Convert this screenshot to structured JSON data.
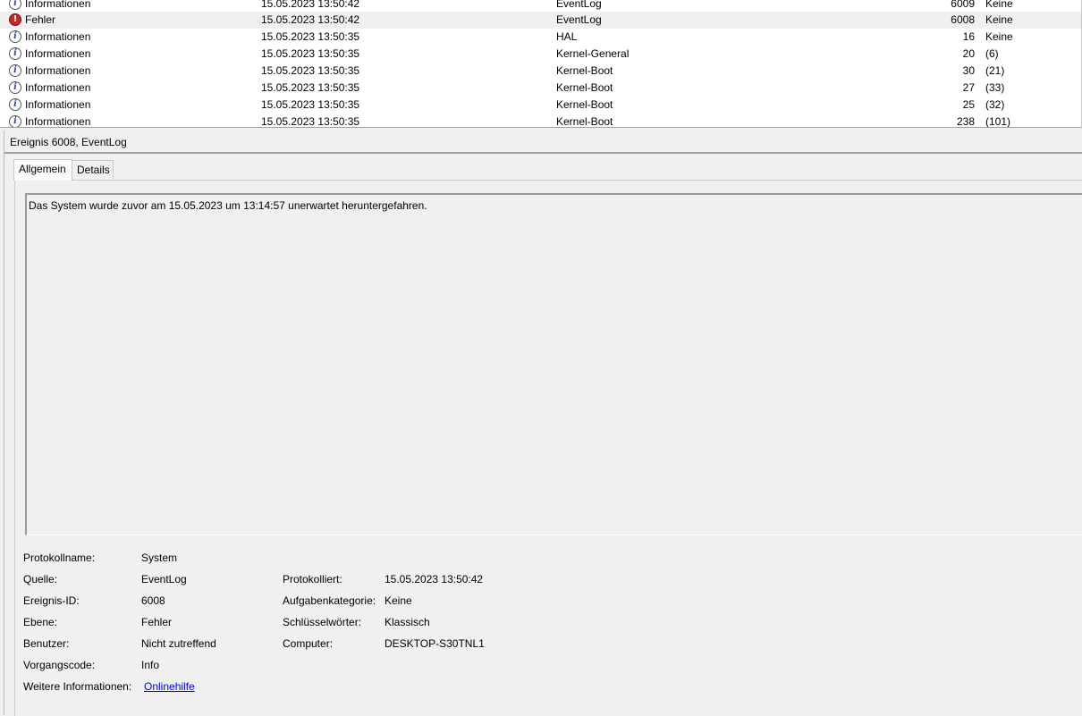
{
  "events": [
    {
      "level": "Informationen",
      "icon": "info",
      "date": "15.05.2023 13:50:42",
      "source": "EventLog",
      "id": "6009",
      "task": "Keine",
      "selected": false
    },
    {
      "level": "Fehler",
      "icon": "error",
      "date": "15.05.2023 13:50:42",
      "source": "EventLog",
      "id": "6008",
      "task": "Keine",
      "selected": true
    },
    {
      "level": "Informationen",
      "icon": "info",
      "date": "15.05.2023 13:50:35",
      "source": "HAL",
      "id": "16",
      "task": "Keine",
      "selected": false
    },
    {
      "level": "Informationen",
      "icon": "info",
      "date": "15.05.2023 13:50:35",
      "source": "Kernel-General",
      "id": "20",
      "task": "(6)",
      "selected": false
    },
    {
      "level": "Informationen",
      "icon": "info",
      "date": "15.05.2023 13:50:35",
      "source": "Kernel-Boot",
      "id": "30",
      "task": "(21)",
      "selected": false
    },
    {
      "level": "Informationen",
      "icon": "info",
      "date": "15.05.2023 13:50:35",
      "source": "Kernel-Boot",
      "id": "27",
      "task": "(33)",
      "selected": false
    },
    {
      "level": "Informationen",
      "icon": "info",
      "date": "15.05.2023 13:50:35",
      "source": "Kernel-Boot",
      "id": "25",
      "task": "(32)",
      "selected": false
    },
    {
      "level": "Informationen",
      "icon": "info",
      "date": "15.05.2023 13:50:35",
      "source": "Kernel-Boot",
      "id": "238",
      "task": "(101)",
      "selected": false
    }
  ],
  "detail": {
    "title": "Ereignis 6008, EventLog",
    "tabs": [
      "Allgemein",
      "Details"
    ],
    "description": "Das System wurde zuvor am 15.05.2023 um 13:14:57 unerwartet heruntergefahren.",
    "props": {
      "log_name_label": "Protokollname:",
      "log_name": "System",
      "source_label": "Quelle:",
      "source": "EventLog",
      "logged_label": "Protokolliert:",
      "logged": "15.05.2023 13:50:42",
      "event_id_label": "Ereignis-ID:",
      "event_id": "6008",
      "task_label": "Aufgabenkategorie:",
      "task": "Keine",
      "level_label": "Ebene:",
      "level": "Fehler",
      "keywords_label": "Schlüsselwörter:",
      "keywords": "Klassisch",
      "user_label": "Benutzer:",
      "user": "Nicht zutreffend",
      "computer_label": "Computer:",
      "computer": "DESKTOP-S30TNL1",
      "opcode_label": "Vorgangscode:",
      "opcode": "Info",
      "more_info_label": "Weitere Informationen:",
      "more_info_link": "Onlinehilfe"
    }
  },
  "colors": {
    "selected_row": "#f0f0f0",
    "error_icon": "#c62828",
    "link": "#0000ee"
  }
}
